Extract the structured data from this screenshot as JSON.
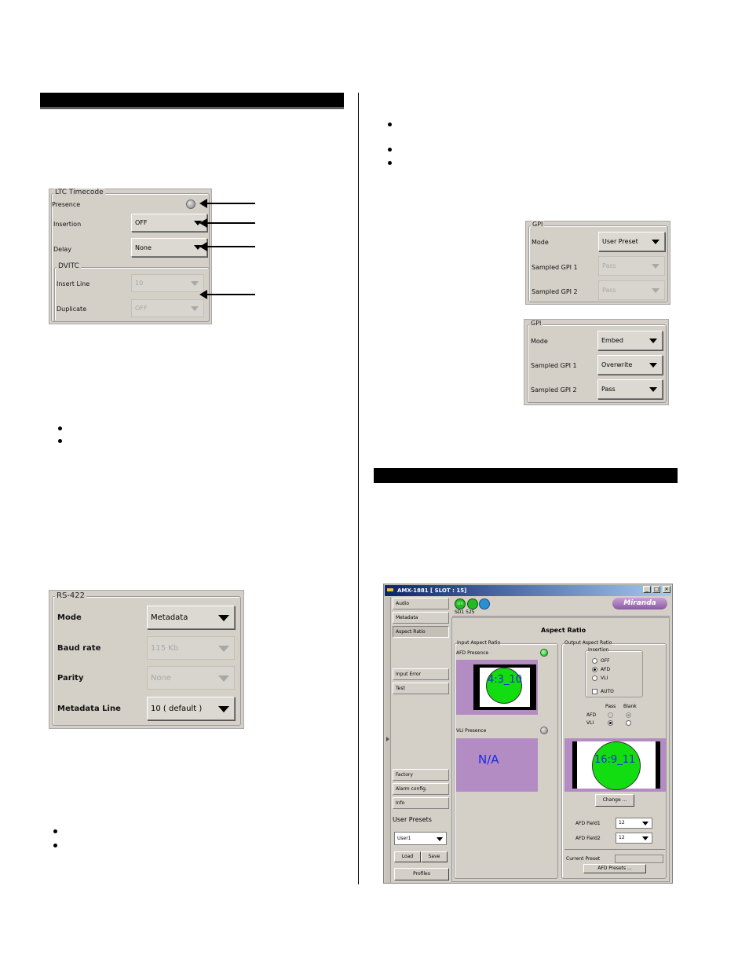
{
  "ltc_panel": {
    "legend": "LTC Timecode",
    "presence_label": "Presence",
    "insertion_label": "Insertion",
    "insertion_value": "OFF",
    "delay_label": "Delay",
    "delay_value": "None",
    "dvitc_legend": "DVITC",
    "insert_line_label": "Insert Line",
    "insert_line_value": "10",
    "duplicate_label": "Duplicate",
    "duplicate_value": "OFF"
  },
  "rs422_panel": {
    "legend": "RS-422",
    "mode_label": "Mode",
    "mode_value": "Metadata",
    "baud_label": "Baud rate",
    "baud_value": "115 Kb",
    "parity_label": "Parity",
    "parity_value": "None",
    "metadata_line_label": "Metadata Line",
    "metadata_line_value": "10 ( default )"
  },
  "gpi_panel_1": {
    "legend": "GPI",
    "mode_label": "Mode",
    "mode_value": "User Preset",
    "gpi1_label": "Sampled GPI 1",
    "gpi1_value": "Pass",
    "gpi2_label": "Sampled GPI 2",
    "gpi2_value": "Pass"
  },
  "gpi_panel_2": {
    "legend": "GPI",
    "mode_label": "Mode",
    "mode_value": "Embed",
    "gpi1_label": "Sampled GPI 1",
    "gpi1_value": "Overwrite",
    "gpi2_label": "Sampled GPI 2",
    "gpi2_value": "Pass"
  },
  "app_window": {
    "title": "AMX-1881 [ SLOT : 15]",
    "brand": "Miranda",
    "status_text": "SD1 525",
    "nav": [
      "Audio",
      "Metadata",
      "Aspect Ratio",
      "Input Error",
      "Test",
      "Factory",
      "Alarm config.",
      "Info"
    ],
    "user_presets_label": "User Presets",
    "user_preset_value": "User1",
    "load_label": "Load",
    "save_label": "Save",
    "profiles_label": "Profiles",
    "heading": "Aspect Ratio",
    "input_group": "Input Aspect Ratio",
    "afd_presence": "AFD Presence",
    "afd_code": "4:3_10",
    "vli_presence": "VLI Presence",
    "vli_na": "N/A",
    "output_group": "Output Aspect Ratio",
    "insertion_group": "Insertion",
    "radio_off": "OFF",
    "radio_afd": "AFD",
    "radio_vli": "VLI",
    "auto_label": "AUTO",
    "pass_label": "Pass",
    "blank_label": "Blank",
    "afd_row": "AFD",
    "vli_row": "VLI",
    "output_code": "16:9_11",
    "change_label": "Change ...",
    "afd_field1_label": "AFD Field1",
    "afd_field1_value": "12",
    "afd_field2_label": "AFD Field2",
    "afd_field2_value": "12",
    "current_preset_label": "Current Preset",
    "afd_presets_label": "AFD Presets ..."
  },
  "colors": {
    "panel_bg": "#d4d0c8",
    "purple": "#b38cc4",
    "green": "#11dd11"
  }
}
